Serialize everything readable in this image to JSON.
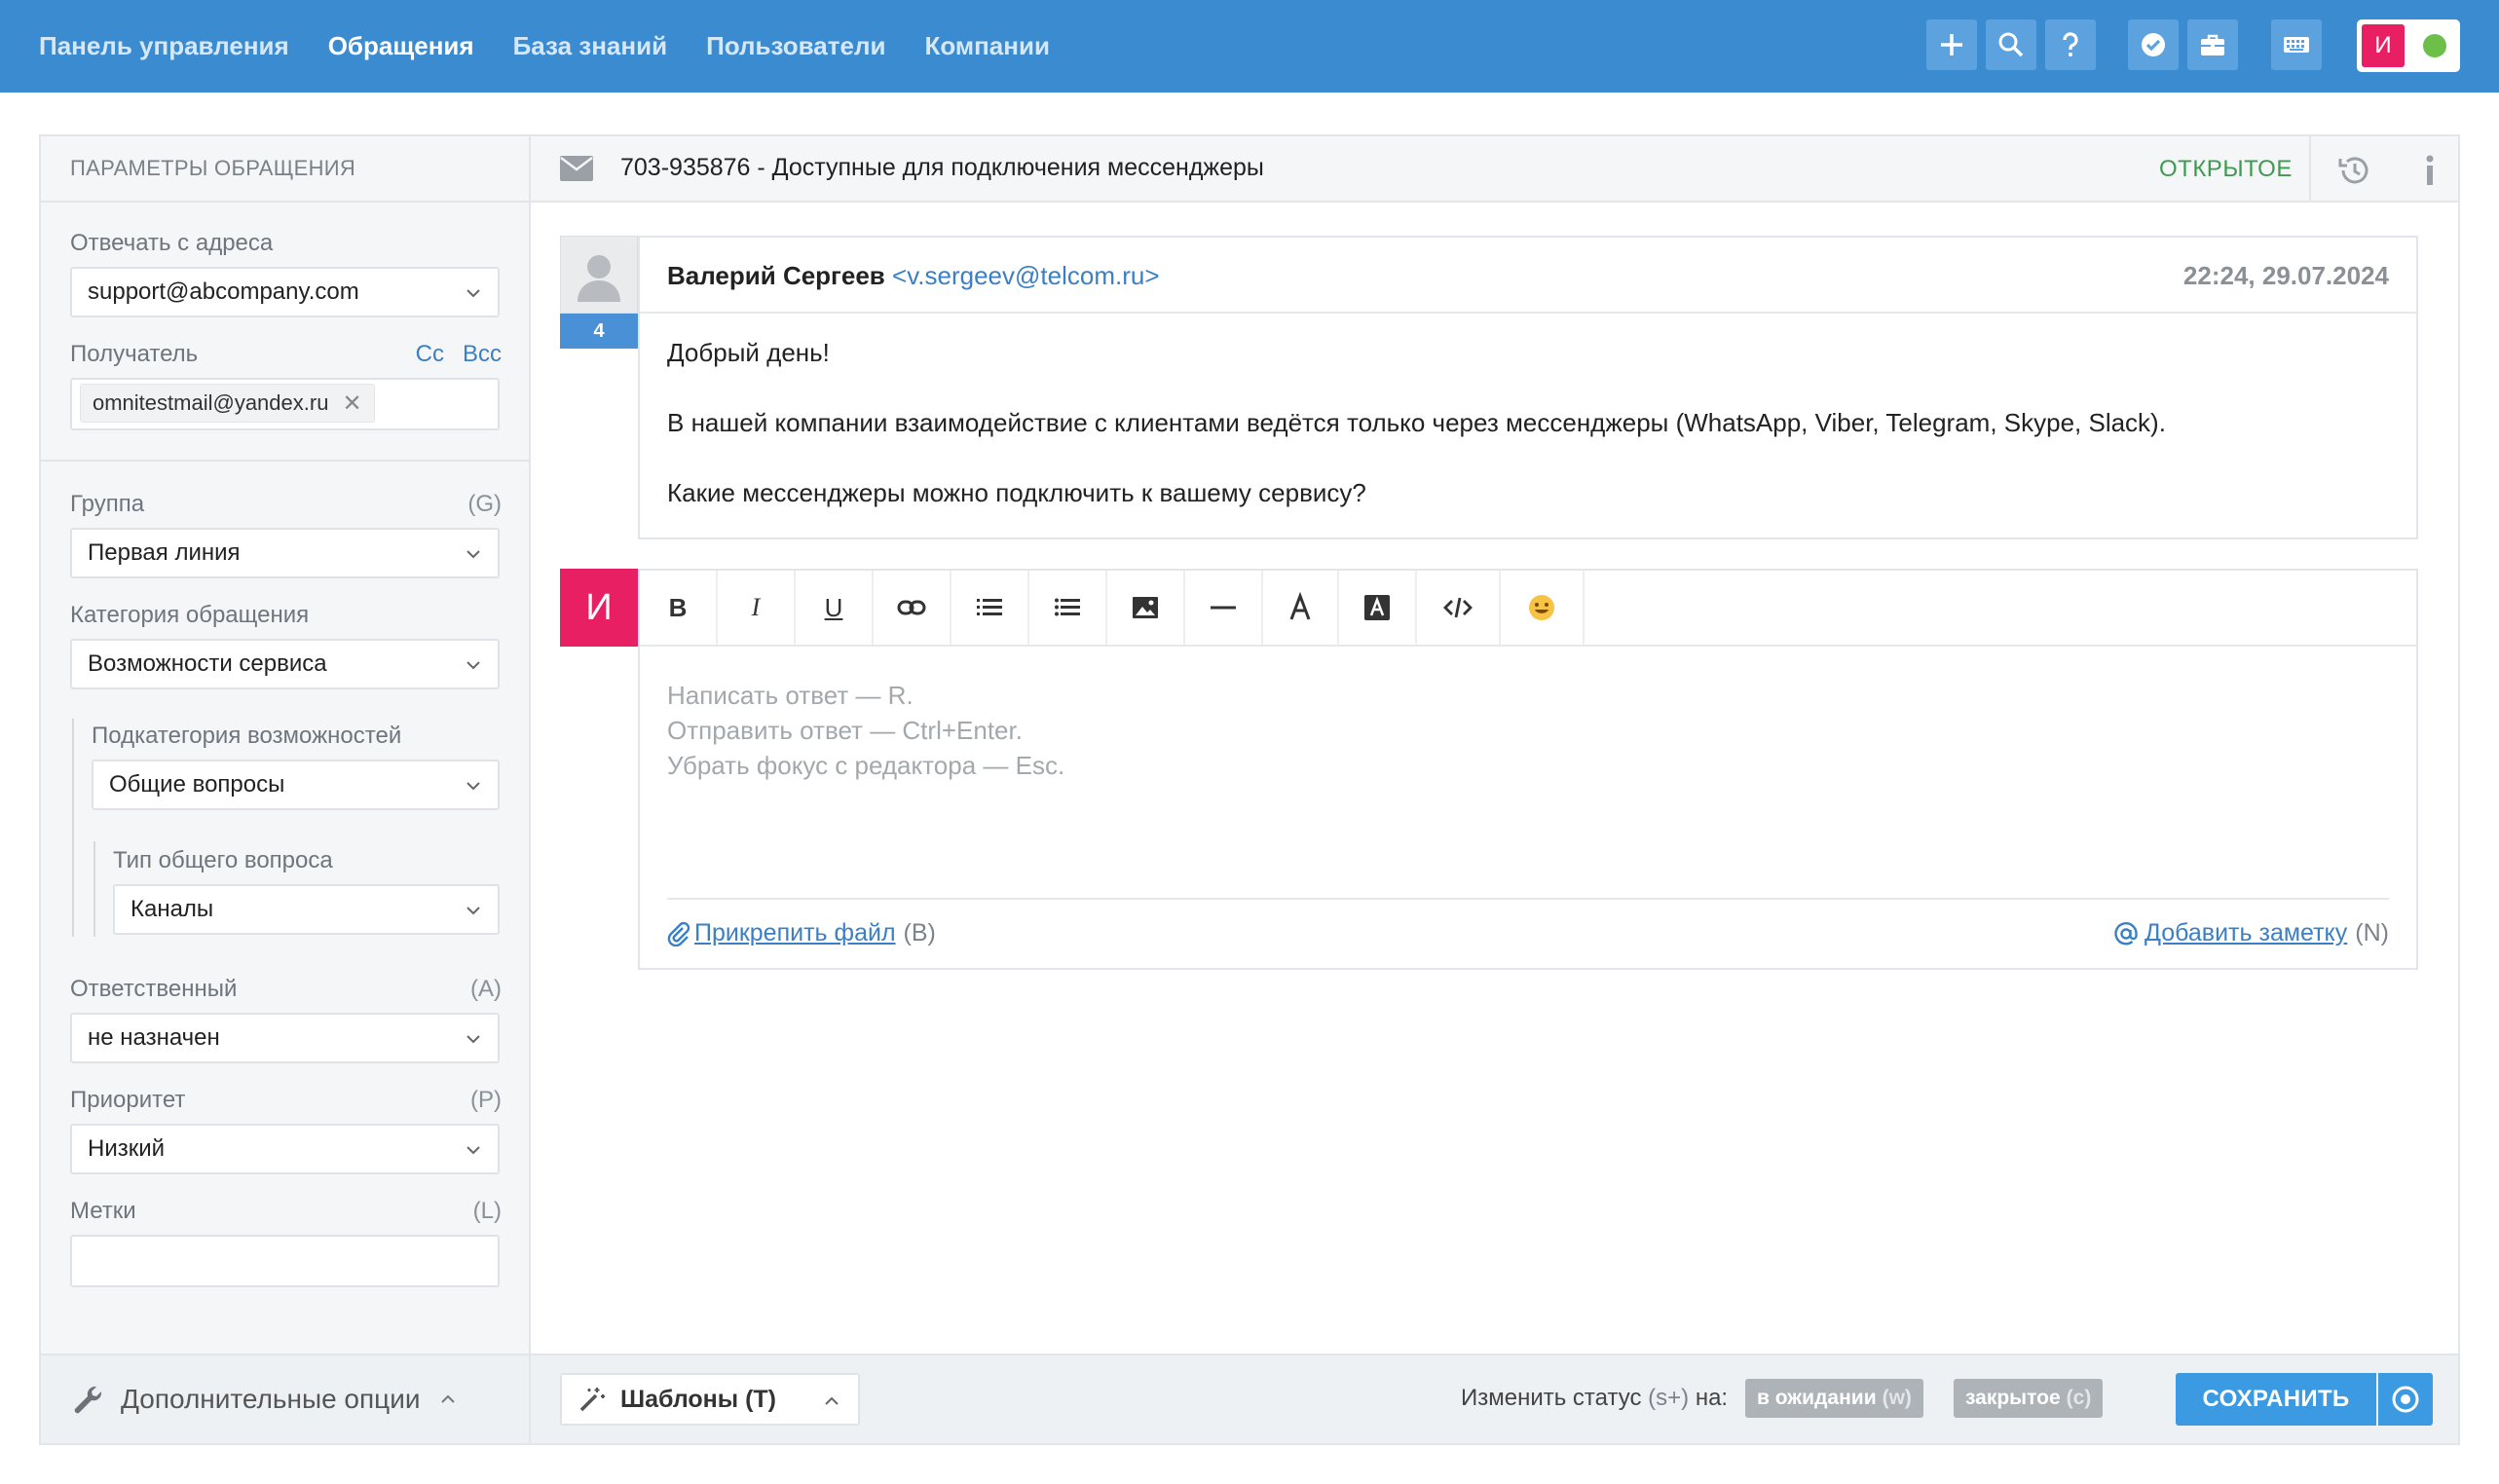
{
  "nav": {
    "items": [
      {
        "label": "Панель управления",
        "active": false
      },
      {
        "label": "Обращения",
        "active": true
      },
      {
        "label": "База знаний",
        "active": false
      },
      {
        "label": "Пользователи",
        "active": false
      },
      {
        "label": "Компании",
        "active": false
      }
    ],
    "actions": [
      "plus-icon",
      "search-icon",
      "help-icon",
      "check-badge-icon",
      "briefcase-icon",
      "keyboard-icon"
    ],
    "user_initial": "И",
    "user_status_color": "#6cc04a"
  },
  "sidebar": {
    "title": "Параметры обращения",
    "reply_from_label": "Отвечать с адреса",
    "reply_from_value": "support@abcompany.com",
    "recipient_label": "Получатель",
    "cc_label": "Cc",
    "bcc_label": "Bcc",
    "recipient_tag": "omnitestmail@yandex.ru",
    "tag_remove": "✕",
    "group_label": "Группа",
    "group_hint": "(G)",
    "group_value": "Первая линия",
    "category_label": "Категория обращения",
    "category_value": "Возможности сервиса",
    "subcategory_label": "Подкатегория возможностей",
    "subcategory_value": "Общие вопросы",
    "question_type_label": "Тип общего вопроса",
    "question_type_value": "Каналы",
    "assignee_label": "Ответственный",
    "assignee_hint": "(A)",
    "assignee_value": "не назначен",
    "priority_label": "Приоритет",
    "priority_hint": "(P)",
    "priority_value": "Низкий",
    "tags_label": "Метки",
    "tags_hint": "(L)",
    "tags_value": "",
    "extra_options_label": "Дополнительные опции"
  },
  "ticket": {
    "title": "703-935876 - Доступные для подключения мессенджеры",
    "status": "ОТКРЫТОЕ"
  },
  "message": {
    "author": "Валерий Сергеев",
    "email": "<v.sergeev@telcom.ru>",
    "date": "22:24, 29.07.2024",
    "count": "4",
    "lines": [
      "Добрый день!",
      "В нашей компании взаимодействие с клиентами ведётся только через мессенджеры (WhatsApp, Viber, Telegram, Skype, Slack).",
      "Какие мессенджеры можно подключить к вашему сервису?"
    ]
  },
  "editor": {
    "avatar_initial": "И",
    "toolbar": {
      "bold": "B",
      "italic": "I",
      "underline": "U"
    },
    "placeholder_lines": [
      "Написать ответ — R.",
      "Отправить ответ — Ctrl+Enter.",
      "Убрать фокус с редактора — Esc."
    ],
    "attach_label": "Прикрепить файл",
    "attach_hint": "(B)",
    "note_label": "Добавить заметку",
    "note_hint": "(N)"
  },
  "footer": {
    "templates_label": "Шаблоны (T)",
    "change_status_label": "Изменить статус",
    "change_status_hint": "(s+)",
    "change_status_suffix": "на:",
    "status_pending": "в ожидании",
    "status_pending_hint": "(w)",
    "status_closed": "закрытое",
    "status_closed_hint": "(c)",
    "save_label": "СОХРАНИТЬ"
  },
  "colors": {
    "topbar": "#3b8bd0",
    "accent_pink": "#e81f63",
    "status_open": "#3e9a4e",
    "link": "#3b7fc4",
    "save": "#3b9ae1"
  }
}
